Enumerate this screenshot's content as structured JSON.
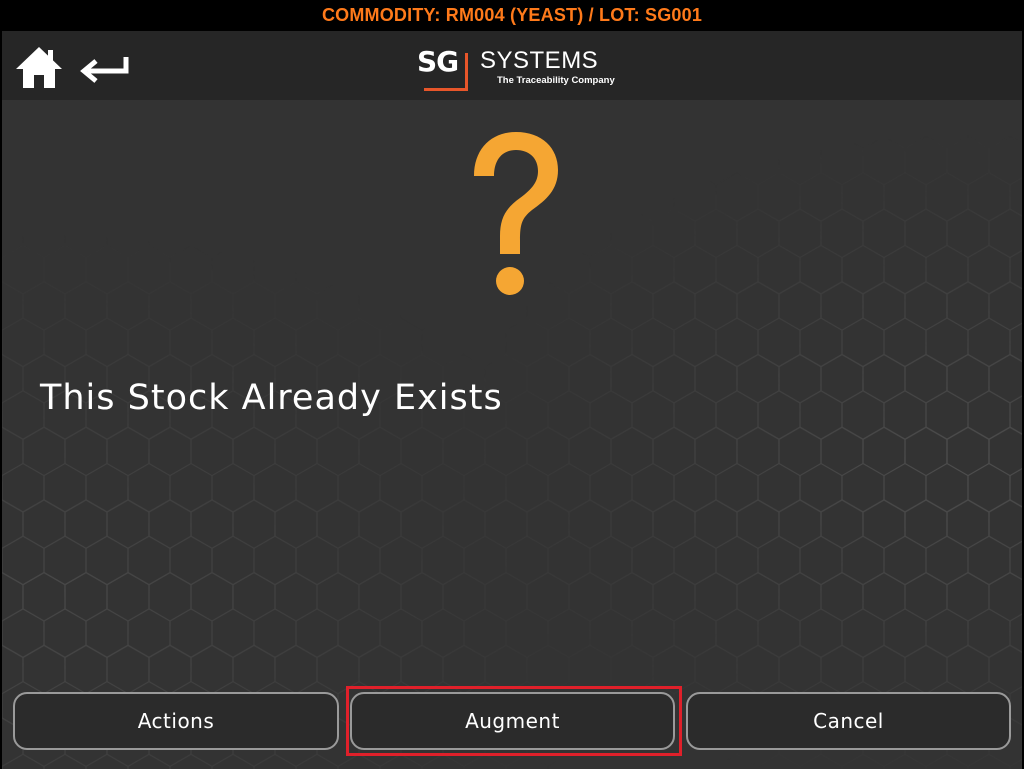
{
  "topbar": {
    "commodity_text": "COMMODITY: RM004 (YEAST) / LOT: SG001",
    "color": "#ff7a1a"
  },
  "header": {
    "icons": {
      "home": "home-icon",
      "back": "return-arrow-icon"
    },
    "logo": {
      "sg": "SG",
      "systems": "SYSTEMS",
      "tagline": "The Traceability Company",
      "accent": "#e8562a"
    }
  },
  "dialog": {
    "icon": "question-mark-icon",
    "icon_color": "#f5a633",
    "message": "This Stock Already Exists"
  },
  "buttons": {
    "actions": "Actions",
    "augment": "Augment",
    "cancel": "Cancel"
  },
  "highlight_color": "#e0202a"
}
